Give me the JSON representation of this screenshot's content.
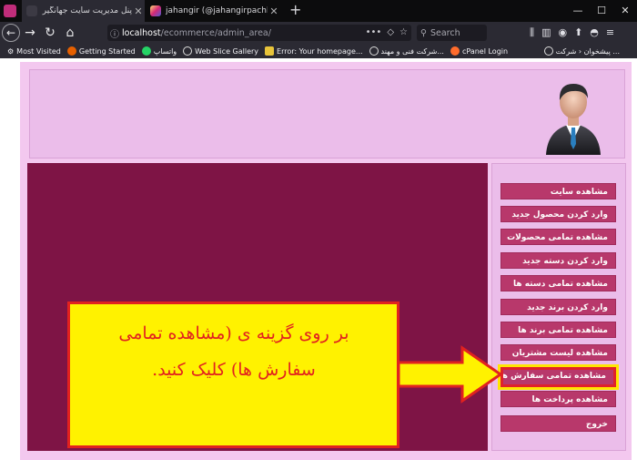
{
  "browser": {
    "tabs": [
      {
        "label": "پنل مدیریت سایت جهانگیر پچکم"
      },
      {
        "label": "jahangir (@jahangirpachkam) • Ins"
      }
    ],
    "url": {
      "host": "localhost",
      "path": "/ecommerce/admin_area/"
    },
    "search_placeholder": "Search",
    "bookmarks": [
      "Most Visited",
      "Getting Started",
      "واتساپ",
      "Web Slice Gallery",
      "Error: Your homepage...",
      "شرکت فنی و مهند...",
      "cPanel Login",
      "پیشخوان ‹ شرکت ..."
    ]
  },
  "sidebar": {
    "items": [
      {
        "label": "مشاهده سایت"
      },
      {
        "label": "وارد کردن محصول جدید"
      },
      {
        "label": "مشاهده تمامی محصولات"
      },
      {
        "label": "وارد کردن دسته جدید"
      },
      {
        "label": "مشاهده تمامی دسته ها"
      },
      {
        "label": "وارد کردن برند جدید"
      },
      {
        "label": "مشاهده تمامی برند ها"
      },
      {
        "label": "مشاهده لیست مشتریان"
      },
      {
        "label": "مشاهده تمامی سفارش ها"
      },
      {
        "label": "مشاهده پرداخت ها"
      },
      {
        "label": "خروج"
      }
    ]
  },
  "callout": {
    "line1": "بر روی گزینه ی (مشاهده تمامی",
    "line2": "سفارش ها) کلیک کنید."
  },
  "colors": {
    "content_bg": "#7e1445",
    "menu_item_bg": "#b8386b",
    "frame_bg": "#f3c8ef",
    "callout_bg": "#fff200",
    "callout_border": "#e2221f"
  }
}
